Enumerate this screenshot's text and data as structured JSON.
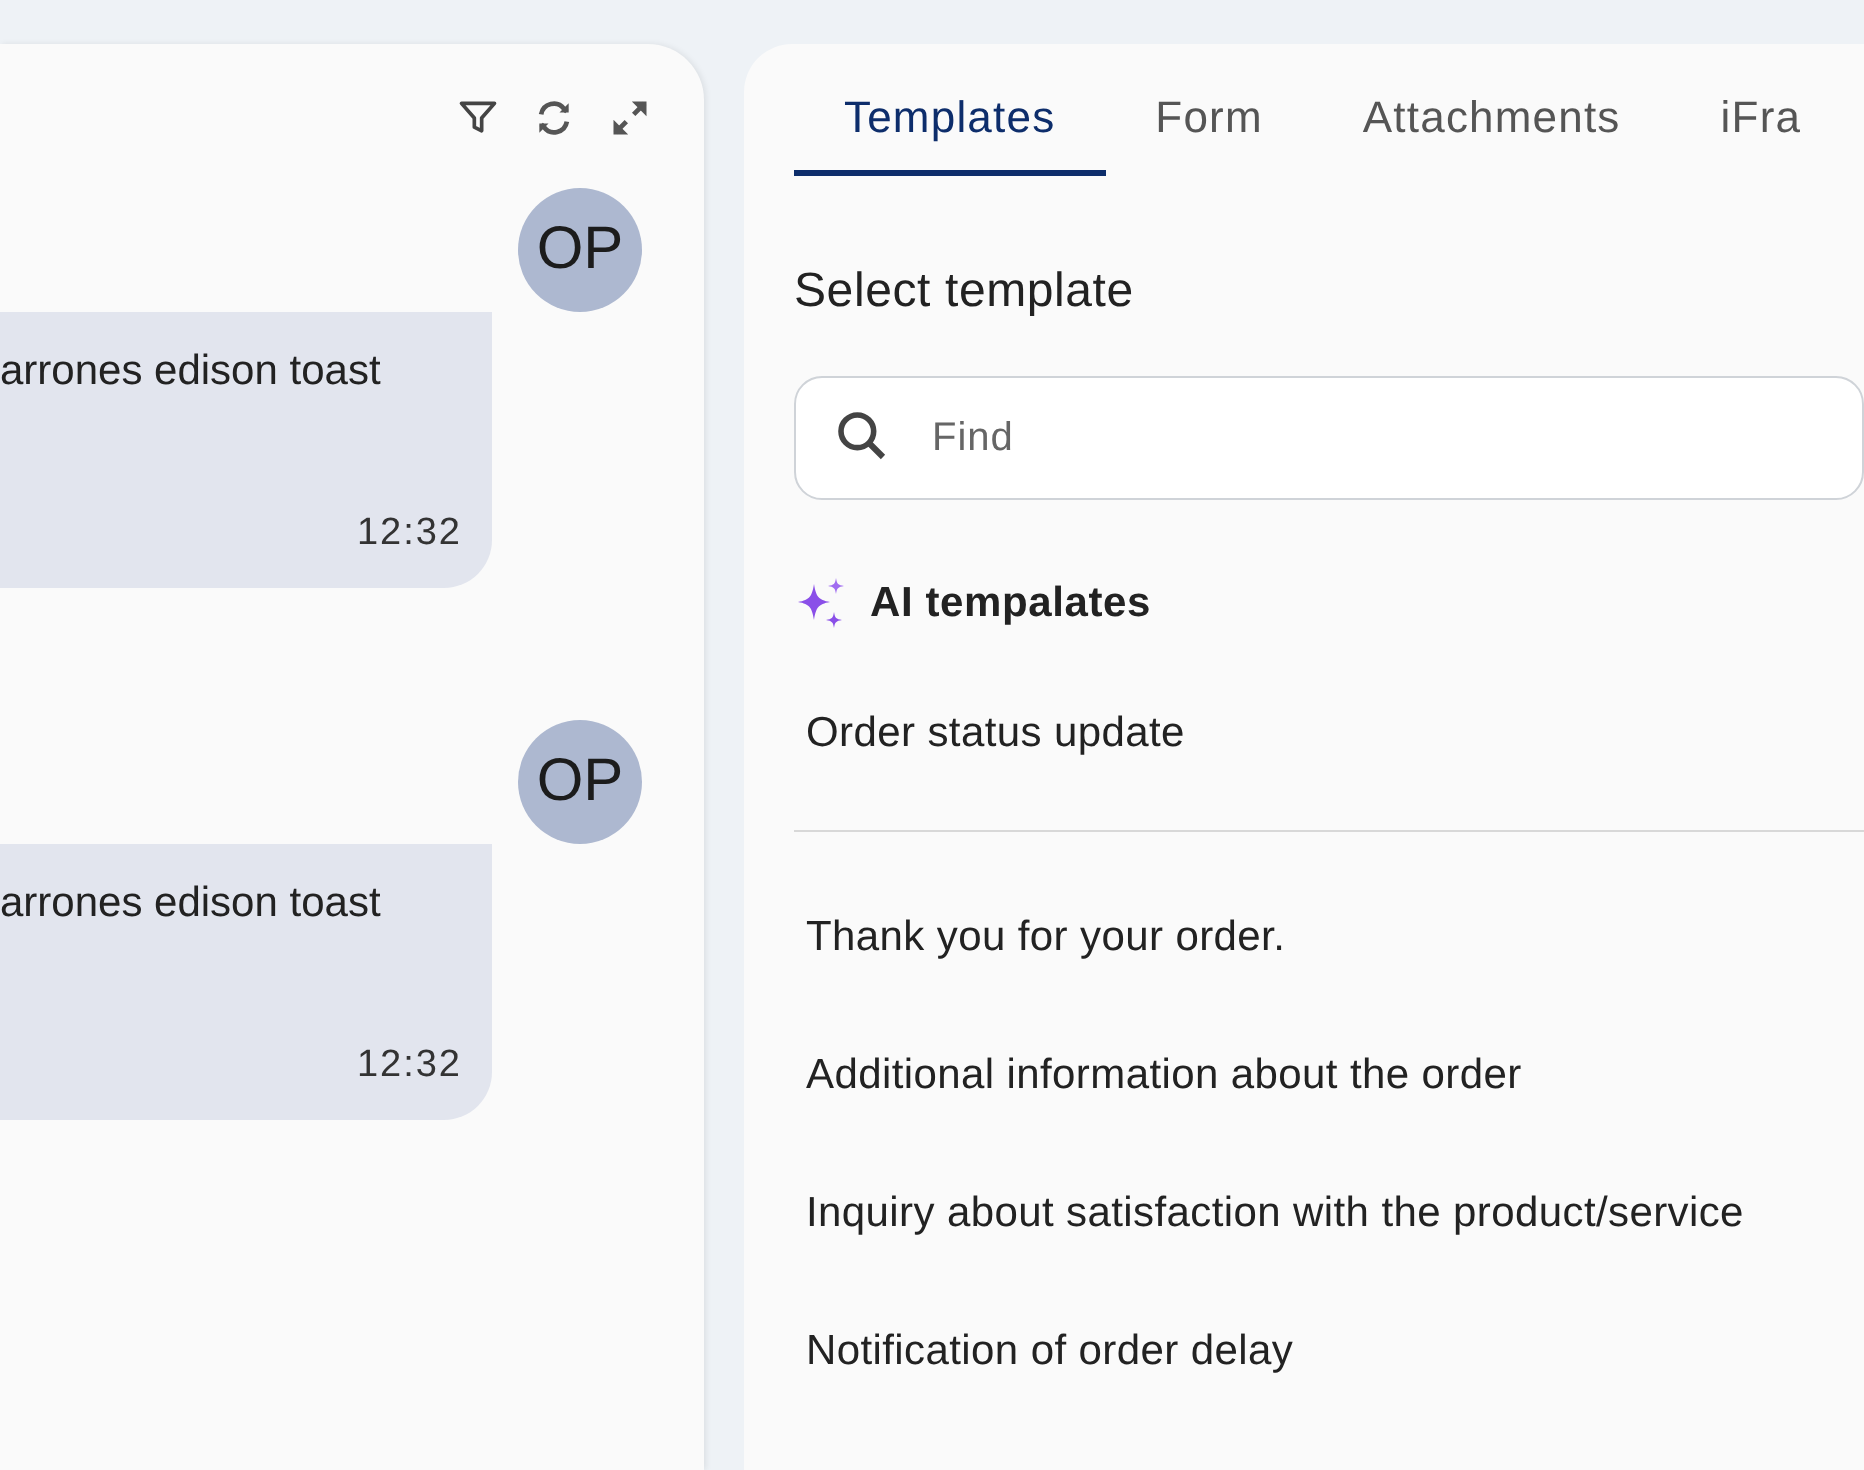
{
  "chat_panel": {
    "toolbar": [
      {
        "kind": "filter"
      },
      {
        "kind": "refresh"
      },
      {
        "kind": "expand"
      }
    ],
    "messages": [
      {
        "avatar": "OP",
        "text": "arrones edison toast",
        "time": "12:32"
      },
      {
        "avatar": "OP",
        "text": "arrones edison toast",
        "time": "12:32"
      }
    ]
  },
  "template_panel": {
    "tabs": [
      {
        "label": "Templates",
        "selected": true
      },
      {
        "label": "Form",
        "selected": false
      },
      {
        "label": "Attachments",
        "selected": false
      },
      {
        "label": "iFra",
        "selected": false
      }
    ],
    "heading": "Select template",
    "search": {
      "placeholder": "Find"
    },
    "ai_section": {
      "title": "AI tempalates",
      "items": [
        "Order status update"
      ]
    },
    "templates": [
      "Thank you for your order.",
      "Additional information about the order",
      "Inquiry about satisfaction with the product/service",
      "Notification of order delay"
    ]
  }
}
